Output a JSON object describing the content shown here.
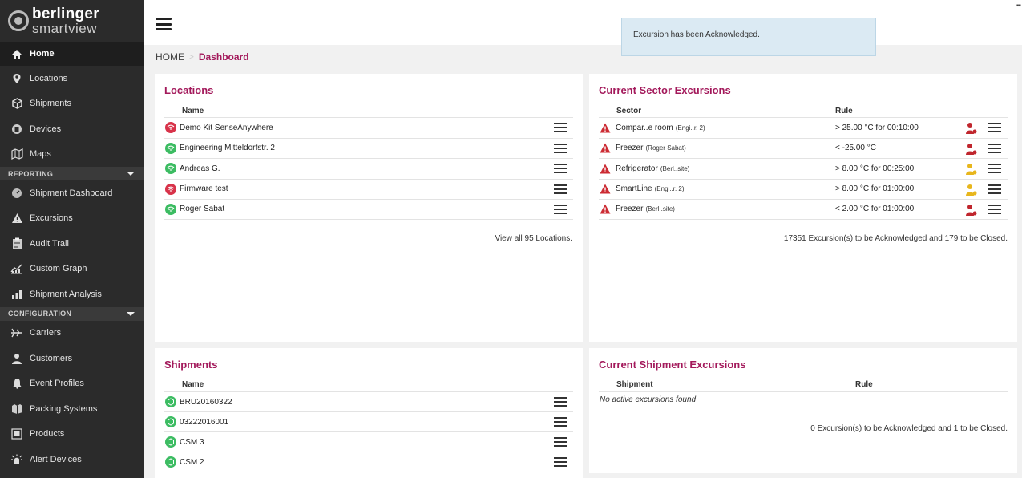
{
  "brand": {
    "top": "berlinger",
    "bottom": "smartview"
  },
  "sidebar": {
    "items": [
      {
        "label": "Home",
        "icon": "home-icon"
      },
      {
        "label": "Locations",
        "icon": "location-pin-icon"
      },
      {
        "label": "Shipments",
        "icon": "box-icon"
      },
      {
        "label": "Devices",
        "icon": "device-icon"
      },
      {
        "label": "Maps",
        "icon": "map-icon"
      }
    ],
    "reporting_label": "REPORTING",
    "reporting_items": [
      {
        "label": "Shipment Dashboard",
        "icon": "gauge-icon"
      },
      {
        "label": "Excursions",
        "icon": "warning-icon"
      },
      {
        "label": "Audit Trail",
        "icon": "clipboard-icon"
      },
      {
        "label": "Custom Graph",
        "icon": "graph-icon"
      },
      {
        "label": "Shipment Analysis",
        "icon": "bar-chart-icon"
      }
    ],
    "configuration_label": "CONFIGURATION",
    "configuration_items": [
      {
        "label": "Carriers",
        "icon": "plane-icon"
      },
      {
        "label": "Customers",
        "icon": "user-icon"
      },
      {
        "label": "Event Profiles",
        "icon": "bell-icon"
      },
      {
        "label": "Packing Systems",
        "icon": "packing-icon"
      },
      {
        "label": "Products",
        "icon": "product-icon"
      },
      {
        "label": "Alert Devices",
        "icon": "alert-icon"
      }
    ]
  },
  "toast": {
    "message": "Excursion has been Acknowledged."
  },
  "breadcrumb": {
    "home": "HOME",
    "separator": ">",
    "current": "Dashboard"
  },
  "locations_panel": {
    "title": "Locations",
    "col_name": "Name",
    "rows": [
      {
        "name": "Demo Kit SenseAnywhere",
        "status": "red"
      },
      {
        "name": "Engineering Mitteldorfstr. 2",
        "status": "green"
      },
      {
        "name": "Andreas G.",
        "status": "green"
      },
      {
        "name": "Firmware test",
        "status": "red"
      },
      {
        "name": "Roger Sabat",
        "status": "green"
      }
    ],
    "view_all": "View all 95 Locations."
  },
  "sector_panel": {
    "title": "Current Sector Excursions",
    "col_sector": "Sector",
    "col_rule": "Rule",
    "rows": [
      {
        "name": "Compar..e room",
        "sub": "(Engi..r. 2)",
        "rule": "> 25.00 °C for 00:10:00",
        "person_color": "#c0262d"
      },
      {
        "name": "Freezer",
        "sub": "(Roger Sabat)",
        "rule": "< -25.00 °C",
        "person_color": "#c0262d"
      },
      {
        "name": "Refrigerator",
        "sub": "(Berl..site)",
        "rule": "> 8.00 °C for 00:25:00",
        "person_color": "#e8b61c"
      },
      {
        "name": "SmartLine",
        "sub": "(Engi..r. 2)",
        "rule": "> 8.00 °C for 01:00:00",
        "person_color": "#e8b61c"
      },
      {
        "name": "Freezer",
        "sub": "(Berl..site)",
        "rule": "< 2.00 °C for 01:00:00",
        "person_color": "#c0262d"
      }
    ],
    "summary": "17351 Excursion(s) to be Acknowledged and 179 to be Closed."
  },
  "shipments_panel": {
    "title": "Shipments",
    "col_name": "Name",
    "rows": [
      {
        "name": "BRU20160322"
      },
      {
        "name": "03222016001"
      },
      {
        "name": "CSM 3"
      },
      {
        "name": "CSM 2"
      }
    ]
  },
  "shipment_exc_panel": {
    "title": "Current Shipment Excursions",
    "col_shipment": "Shipment",
    "col_rule": "Rule",
    "empty": "No active excursions found",
    "summary": "0 Excursion(s) to be Acknowledged and 1 to be Closed."
  },
  "colors": {
    "accent": "#a3195b",
    "sidebar_bg": "#2b2b2b",
    "status_red": "#d8334a",
    "status_green": "#3cbc62",
    "toast_bg": "#dbeaf3"
  }
}
